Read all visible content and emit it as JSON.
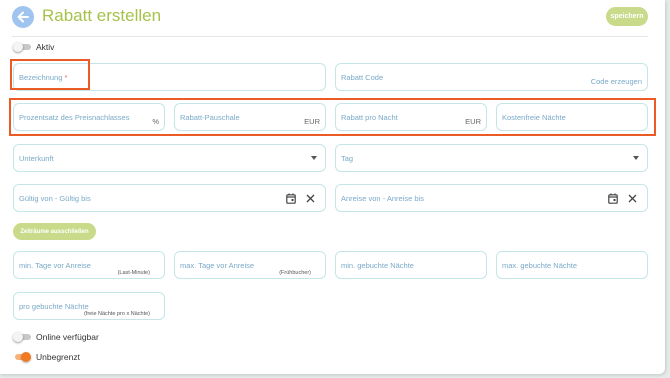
{
  "header": {
    "title": "Rabatt erstellen",
    "save_label": "speichern"
  },
  "toggles": {
    "active": {
      "label": "Aktiv",
      "on": false
    },
    "online": {
      "label": "Online verfügbar",
      "on": false
    },
    "unlimited": {
      "label": "Unbegrenzt",
      "on": true
    }
  },
  "fields": {
    "name": {
      "placeholder": "Bezeichnung",
      "required_mark": "*"
    },
    "code": {
      "placeholder": "Rabatt Code",
      "link": "Code erzeugen"
    },
    "percent": {
      "placeholder": "Prozentsatz des Preisnachlasses",
      "unit": "%"
    },
    "flat": {
      "placeholder": "Rabatt-Pauschale",
      "unit": "EUR"
    },
    "per_night": {
      "placeholder": "Rabatt pro Nacht",
      "unit": "EUR"
    },
    "free_nights": {
      "placeholder": "Kostenfreie Nächte"
    },
    "accommodation": {
      "placeholder": "Unterkunft"
    },
    "day": {
      "placeholder": "Tag"
    },
    "valid_range": {
      "placeholder": "Gültig von - Gültig bis"
    },
    "arrival_range": {
      "placeholder": "Anreise von - Anreise bis"
    },
    "min_days_before": {
      "placeholder": "min. Tage vor Anreise",
      "hint": "(Last-Minute)"
    },
    "max_days_before": {
      "placeholder": "max. Tage vor Anreise",
      "hint": "(Frühbucher)"
    },
    "min_nights": {
      "placeholder": "min. gebuchte Nächte"
    },
    "max_nights": {
      "placeholder": "max. gebuchte Nächte"
    },
    "per_nights": {
      "placeholder": "pro gebuchte Nächte",
      "hint": "(freie Nächte pro x Nächte)"
    }
  },
  "buttons": {
    "exclude_periods": "Zeiträume ausschließen"
  },
  "colors": {
    "title": "#a6c24a",
    "button": "#c9db8a",
    "field_border": "#c4e6e8",
    "placeholder": "#7aa9c8",
    "highlight": "#ec5a26",
    "toggle_on": "#f07a22"
  },
  "icons": {
    "back": "arrow-left-icon",
    "calendar": "calendar-icon",
    "clear": "close-icon",
    "dropdown": "chevron-down-icon"
  }
}
